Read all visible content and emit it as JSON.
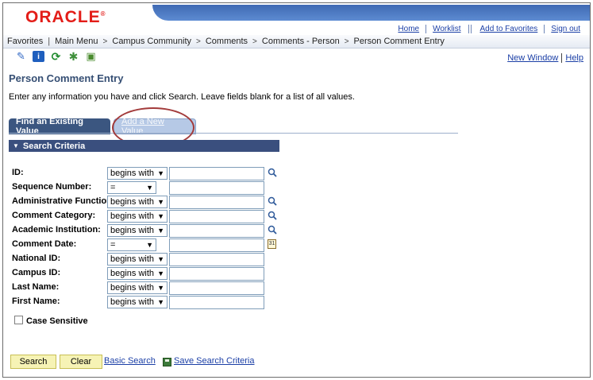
{
  "header": {
    "logo": "ORACLE",
    "logo_mark": "®",
    "top_links": [
      "Home",
      "Worklist",
      "Add to Favorites",
      "Sign out"
    ]
  },
  "nav": {
    "favorites": "Favorites",
    "main_menu": "Main Menu",
    "breadcrumbs": [
      "Campus Community",
      "Comments",
      "Comments - Person",
      "Person Comment Entry"
    ]
  },
  "toolbar": {
    "icons": [
      "spell-check-icon",
      "info-icon",
      "refresh-icon",
      "settings-icon",
      "notepad-icon"
    ],
    "new_window": "New Window",
    "help": "Help"
  },
  "page": {
    "title": "Person Comment Entry",
    "instructions": "Enter any information you have and click Search. Leave fields blank for a list of all values.",
    "tabs": [
      "Find an Existing Value",
      "Add a New Value"
    ],
    "section": "Search Criteria"
  },
  "fields": [
    {
      "label": "ID:",
      "operator": "begins with",
      "value": "",
      "lookup": true
    },
    {
      "label": "Sequence Number:",
      "operator": "=",
      "value": ""
    },
    {
      "label": "Administrative Function:",
      "operator": "begins with",
      "value": "",
      "lookup": true
    },
    {
      "label": "Comment Category:",
      "operator": "begins with",
      "value": "",
      "lookup": true
    },
    {
      "label": "Academic Institution:",
      "operator": "begins with",
      "value": "",
      "lookup": true
    },
    {
      "label": "Comment Date:",
      "operator": "=",
      "value": "",
      "calendar": true
    },
    {
      "label": "National ID:",
      "operator": "begins with",
      "value": ""
    },
    {
      "label": "Campus ID:",
      "operator": "begins with",
      "value": ""
    },
    {
      "label": "Last Name:",
      "operator": "begins with",
      "value": ""
    },
    {
      "label": "First Name:",
      "operator": "begins with",
      "value": ""
    }
  ],
  "case_sensitive": {
    "label": "Case Sensitive",
    "checked": false
  },
  "actions": {
    "search": "Search",
    "clear": "Clear",
    "basic_search": "Basic Search",
    "save_criteria": "Save Search Criteria"
  },
  "colors": {
    "logo_red": "#e31d18",
    "header_blue": "#3f6ab3",
    "tab_active": "#3b5680",
    "section_bar": "#3a4f7e",
    "button_yellow": "#f6f3b5",
    "annotation_circle": "#a33b3b"
  }
}
